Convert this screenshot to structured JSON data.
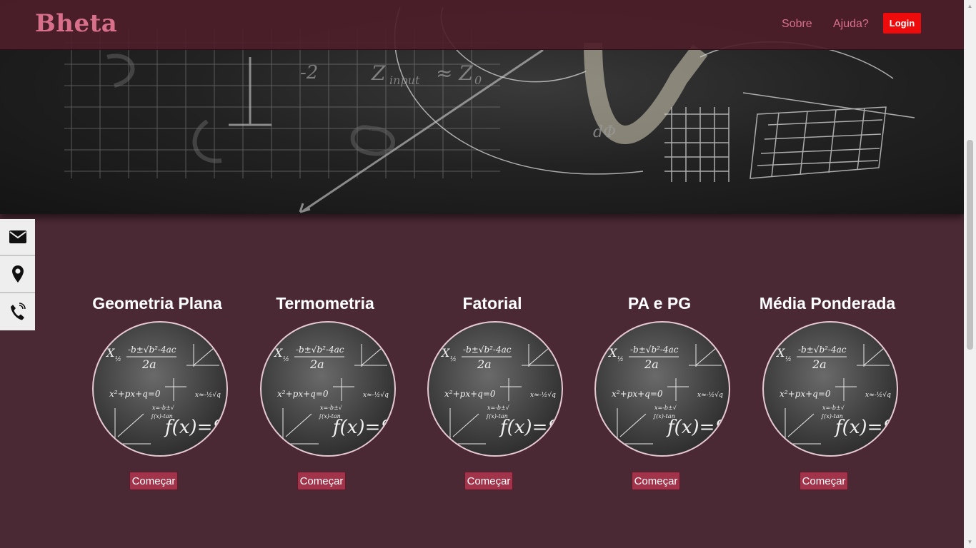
{
  "header": {
    "brand": "Bheta",
    "nav": {
      "about": "Sobre",
      "help": "Ajuda?"
    },
    "login_label": "Login"
  },
  "side_bar": {
    "icons": [
      "envelope-icon",
      "map-pin-icon",
      "phone-icon"
    ]
  },
  "cards": [
    {
      "title": "Geometria Plana",
      "button": "Começar"
    },
    {
      "title": "Termometria",
      "button": "Começar"
    },
    {
      "title": "Fatorial",
      "button": "Começar"
    },
    {
      "title": "PA e PG",
      "button": "Começar"
    },
    {
      "title": "Média Ponderada",
      "button": "Começar"
    }
  ],
  "colors": {
    "background": "#4a2834",
    "navbar": "#4e1e2a",
    "brand": "#d9708b",
    "login": "#ee0b0b",
    "start_button": "#a1334b"
  }
}
